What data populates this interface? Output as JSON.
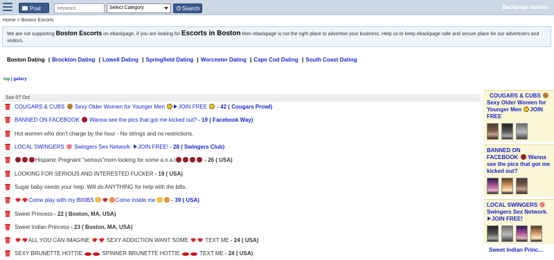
{
  "header": {
    "post_label": "Post ad",
    "keyword_placeholder": "keyword",
    "category_value": "Select Category",
    "search_label": "Search",
    "brand": "Backpage boston"
  },
  "breadcrumb": {
    "home": "Home",
    "sep": " > ",
    "current": "Boston Escorts"
  },
  "notice": {
    "p1": "We are not supporting ",
    "b1": "Boston Escorts",
    "p2": " on ebackpage, if you are looking for ",
    "b2": "Escorts in Boston",
    "p3": " then ebackpage is not the right place to advertise your business. Help us to keep ebackpage safe and secure place for our advertisers and visitors."
  },
  "citynav": {
    "current": "Boston Dating",
    "links": [
      "Brockton Dating",
      "Lowell Dating",
      "Springfield Dating",
      "Worcester Dating",
      "Cape Cod Dating",
      "South Coast Dating"
    ],
    "separator": "|"
  },
  "view": {
    "top": "top",
    "sep": " | ",
    "gallery": "gallery"
  },
  "date_header": "Sun 07 Oct",
  "listings": [
    {
      "pre": "COUGARS & CUBS ",
      "mid": " Sexy Older Women for Younger Men ",
      "post": "JOIN FREE ",
      "loc": " - 42 ( Cougars Prowl)"
    },
    {
      "pre": "BANNED ON FACEBOOK ",
      "mid": " Wanna see the pics that got me kicked out?",
      "loc": " - 19 ( Facebook Way)"
    },
    {
      "pre": "Hot women who don't charge by the hour - No strings and no restrictions."
    },
    {
      "pre": "LOCAL SWINGERS ",
      "mid": " Swingers Sex Network. ",
      "post": "JOIN FREE!",
      "loc": " - 28 ( Swingers Club)"
    },
    {
      "pre": "Hispanic Pregnant ''serious''mom looking for some a.n.a.l",
      "loc": " - 26 ( USA)"
    },
    {
      "pre": "LOOKING FOR SERIOUS AND INTERESTED FUCKER",
      "loc": " - 19 ( USA)"
    },
    {
      "pre": "Sugar baby needs your help. Will do ANYTHING for help with the bills."
    },
    {
      "pre": "Come play with my B00BS",
      "mid": "Come inside me",
      "loc": " - 39 ( USA)"
    },
    {
      "pre": "Sweet Princess",
      "loc": " - 22 ( Boston, MA, USA)"
    },
    {
      "pre": "Sweet Indian Princess",
      "loc": " - 23 ( Boston, MA, USA)"
    },
    {
      "pre": "ALL YOU CAN IMAGINE ",
      "mid": " SEXY ADDICTION WANT SOME ",
      "post": " TEXT ME",
      "loc": " - 24 ( USA)"
    },
    {
      "pre": "SEXY BRUNETTE HOTTIE ",
      "mid": " SPINNER BRUNETTE HOTTIE ",
      "post": " TEXT ME",
      "loc": " - 24 ( USA)"
    }
  ],
  "sidebar": {
    "cards": [
      {
        "title_a": "COUGARS & CUBS ",
        "title_b": " Sexy Older Women for Younger Men ",
        "title_c": "JOIN FREE"
      },
      {
        "title_a": "BANNED ON FACEBOOK ",
        "title_b": " Wanna see the pics that got me kicked out?"
      },
      {
        "title_a": "LOCAL SWINGERS ",
        "title_b": " Swingers Sex Network. ",
        "title_c": "JOIN FREE!"
      }
    ],
    "tail": "Sweet Indian Princ..."
  },
  "colors": {
    "link": "#1a23c8",
    "header_bar": "#ccd8e6",
    "button": "#3a5a8c",
    "notice_bg": "#eef5fb",
    "sidebar_bg": "#fbf6d6"
  }
}
